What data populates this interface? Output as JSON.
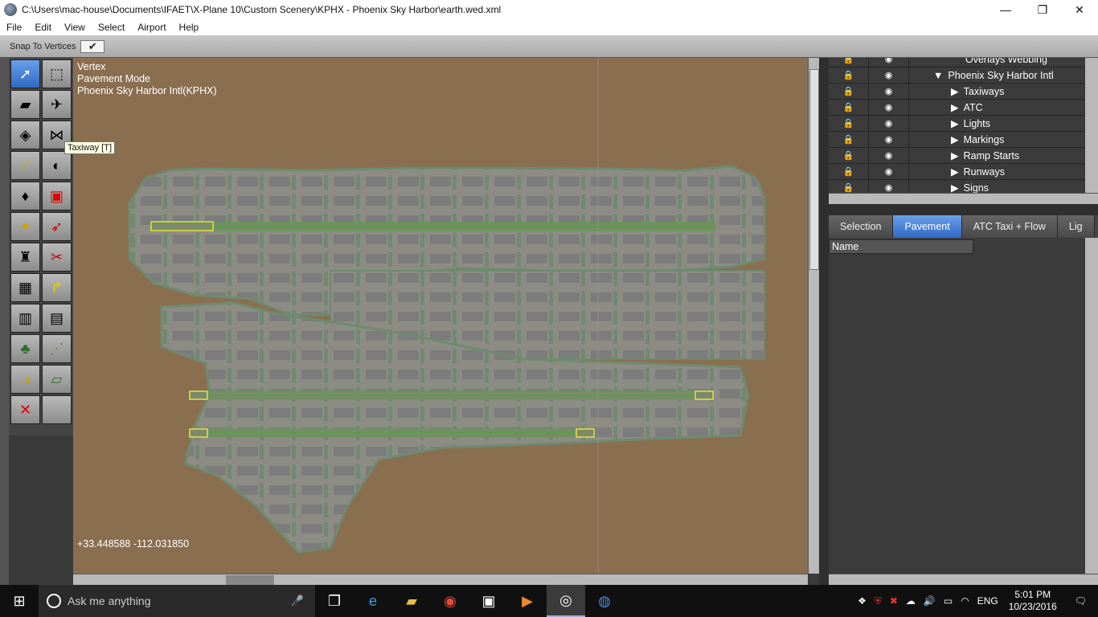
{
  "window": {
    "title": "C:\\Users\\mac-house\\Documents\\IFAET\\X-Plane 10\\Custom Scenery\\KPHX - Phoenix Sky Harbor\\earth.wed.xml",
    "minimize": "—",
    "maximize": "❐",
    "close": "✕"
  },
  "menu": [
    "File",
    "Edit",
    "View",
    "Select",
    "Airport",
    "Help"
  ],
  "snap": {
    "label": "Snap To Vertices",
    "checked": "✔"
  },
  "info": {
    "line1": "Vertex",
    "line2": "Pavement Mode",
    "line3": "Phoenix Sky Harbor Intl(KPHX)"
  },
  "tooltip": "Taxiway [T]",
  "coords": "+33.448588 -112.031850",
  "tree": {
    "items": [
      {
        "label": "Overlays Webbing",
        "arrow": "▶"
      },
      {
        "label": "Phoenix Sky Harbor Intl",
        "arrow": "▼"
      },
      {
        "label": "Taxiways",
        "arrow": "▶"
      },
      {
        "label": "ATC",
        "arrow": "▶"
      },
      {
        "label": "Lights",
        "arrow": "▶"
      },
      {
        "label": "Markings",
        "arrow": "▶"
      },
      {
        "label": "Ramp Starts",
        "arrow": "▶"
      },
      {
        "label": "Runways",
        "arrow": "▶"
      },
      {
        "label": "Signs",
        "arrow": "▶"
      }
    ]
  },
  "tabs": [
    "Selection",
    "Pavement",
    "ATC Taxi + Flow",
    "Lig"
  ],
  "active_tab": "Pavement",
  "props": {
    "header": "Name"
  },
  "taskbar": {
    "search_placeholder": "Ask me anything",
    "language": "ENG",
    "time": "5:01 PM",
    "date": "10/23/2016"
  },
  "colors": {
    "terrain": "#8a6e50",
    "pavement": "#8c8c84",
    "pavement_edge": "#6f8a70",
    "runway": "#57a045",
    "selection": "#e8e040",
    "active_tab": "#3d7bd6"
  }
}
